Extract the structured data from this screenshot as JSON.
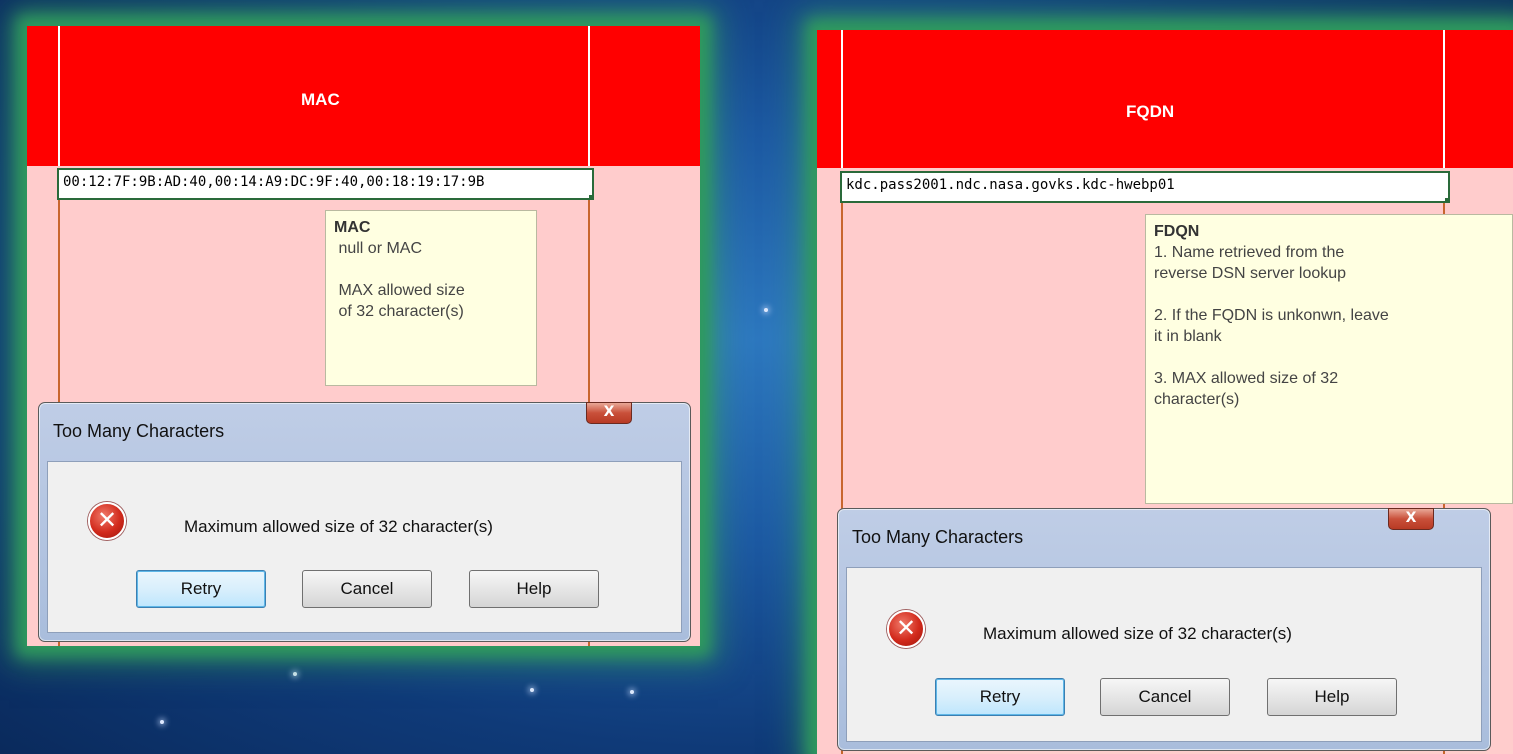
{
  "left_panel": {
    "header": "MAC",
    "cell_value": "00:12:7F:9B:AD:40,00:14:A9:DC:9F:40,00:18:19:17:9B",
    "tooltip": {
      "title": "MAC",
      "line1": " null or MAC",
      "line2": " MAX allowed size",
      "line3": " of 32 character(s)"
    },
    "dialog": {
      "title": "Too Many Characters",
      "close": "X",
      "message": "Maximum allowed size of 32 character(s)",
      "buttons": [
        "Retry",
        "Cancel",
        "Help"
      ]
    }
  },
  "right_panel": {
    "header": "FQDN",
    "cell_value": "kdc.pass2001.ndc.nasa.govks.kdc-hwebp01",
    "tooltip": {
      "title": "FDQN",
      "line1": "1. Name retrieved from the",
      "line2": "reverse DSN server lookup",
      "line3": "2. If the FQDN is unkonwn, leave",
      "line4": "it in blank",
      "line5": "3. MAX allowed size of 32",
      "line6": "character(s)"
    },
    "dialog": {
      "title": "Too Many Characters",
      "close": "X",
      "message": "Maximum allowed size of 32 character(s)",
      "buttons": [
        "Retry",
        "Cancel",
        "Help"
      ]
    }
  },
  "colors": {
    "header_red": "#ff0000",
    "cell_pink": "#ffcccc",
    "glow_green": "#2f9a5e",
    "background_blue": "#1d5aa3"
  }
}
